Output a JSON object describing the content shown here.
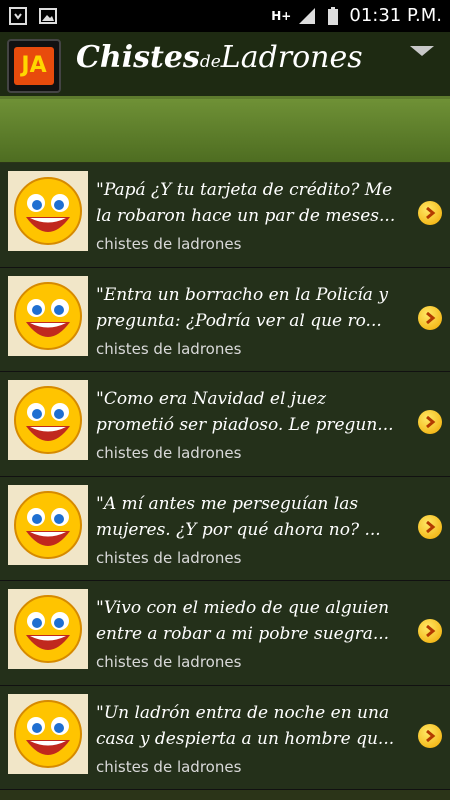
{
  "status_bar": {
    "time": "01:31 P.M.",
    "network": "H+"
  },
  "app": {
    "logo_text": "JA",
    "title_part1": "Chistes",
    "title_part2": "de",
    "title_part3": "Ladrones"
  },
  "items": [
    {
      "line1": "\"Papá ¿Y tu tarjeta de crédito? Me",
      "line2": "la robaron hace un par de meses...",
      "category": "chistes de ladrones"
    },
    {
      "line1": "\"Entra un borracho en la Policía y",
      "line2": "pregunta: ¿Podría ver al que ro...",
      "category": "chistes de ladrones"
    },
    {
      "line1": "\"Como era Navidad el juez",
      "line2": "prometió ser piadoso. Le pregun...",
      "category": "chistes de ladrones"
    },
    {
      "line1": "\"A mí antes me perseguían las",
      "line2": "mujeres.  ¿Y por qué ahora no? ...",
      "category": "chistes de ladrones"
    },
    {
      "line1": "\"Vivo con el miedo de que alguien",
      "line2": "entre a robar a mi pobre suegra...",
      "category": "chistes de ladrones"
    },
    {
      "line1": "\"Un ladrón entra de noche en una",
      "line2": "casa y despierta a un hombre qu...",
      "category": "chistes de ladrones"
    }
  ]
}
